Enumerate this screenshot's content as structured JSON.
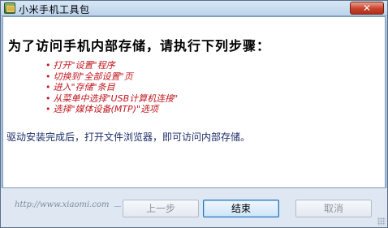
{
  "window": {
    "title": "小米手机工具包",
    "close_glyph": "✕"
  },
  "main": {
    "heading": "为了访问手机内部存储，请执行下列步骤：",
    "steps": [
      "打开\"设置\"程序",
      "切换到\"全部设置\"页",
      "进入\"存储\"条目",
      "从菜单中选择\"USB计算机连接\"",
      "选择\"媒体设备(MTP)\"选项"
    ],
    "note": "驱动安装完成后，打开文件浏览器，即可访问内部存储。"
  },
  "footer": {
    "url": "http://www.xiaomi.com",
    "back_label": "上一步",
    "finish_label": "结束",
    "cancel_label": "取消"
  },
  "colors": {
    "step_text": "#c0181f",
    "note_text": "#1c2f6a",
    "close_button": "#c8422c"
  }
}
